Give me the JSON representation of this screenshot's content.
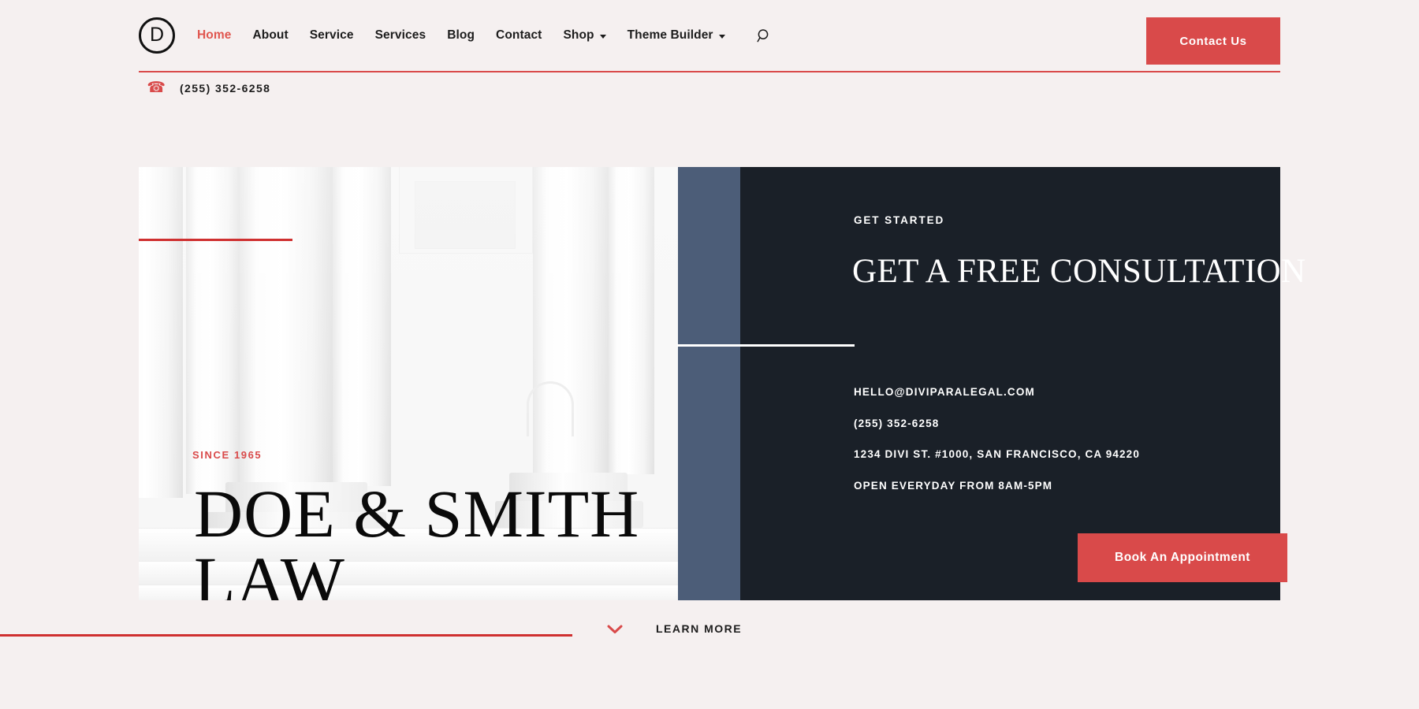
{
  "brand": {
    "logo_letter": "D"
  },
  "nav": {
    "items": [
      {
        "label": "Home",
        "active": true,
        "has_dropdown": false
      },
      {
        "label": "About",
        "active": false,
        "has_dropdown": false
      },
      {
        "label": "Service",
        "active": false,
        "has_dropdown": false
      },
      {
        "label": "Services",
        "active": false,
        "has_dropdown": false
      },
      {
        "label": "Blog",
        "active": false,
        "has_dropdown": false
      },
      {
        "label": "Contact",
        "active": false,
        "has_dropdown": false
      },
      {
        "label": "Shop",
        "active": false,
        "has_dropdown": true
      },
      {
        "label": "Theme Builder",
        "active": false,
        "has_dropdown": true
      }
    ],
    "search_icon": "search-icon",
    "cta_label": "Contact Us"
  },
  "contact_bar": {
    "phone_icon": "phone-icon",
    "phone": "(255) 352-6258"
  },
  "hero": {
    "left": {
      "eyebrow": "SINCE 1965",
      "title_line1": "DOE & SMITH",
      "title_line2": "LAW"
    },
    "right": {
      "eyebrow": "GET STARTED",
      "title": "GET A FREE CONSULTATION",
      "details": [
        "HELLO@DIVIPARALEGAL.COM",
        "(255) 352-6258",
        "1234 DIVI ST. #1000, SAN FRANCISCO, CA 94220",
        "OPEN EVERYDAY FROM 8AM-5PM"
      ],
      "button_label": "Book An Appointment"
    }
  },
  "footer": {
    "chevron_icon": "chevron-down-icon",
    "learn_more_label": "LEARN MORE"
  },
  "colors": {
    "page_bg": "#f5f0f0",
    "accent_red": "#d94a4a",
    "rule_red": "#cf3030",
    "dark_panel": "#1a2028",
    "slate_blue": "#4c5d78",
    "text_dark": "#1c1c1c"
  }
}
